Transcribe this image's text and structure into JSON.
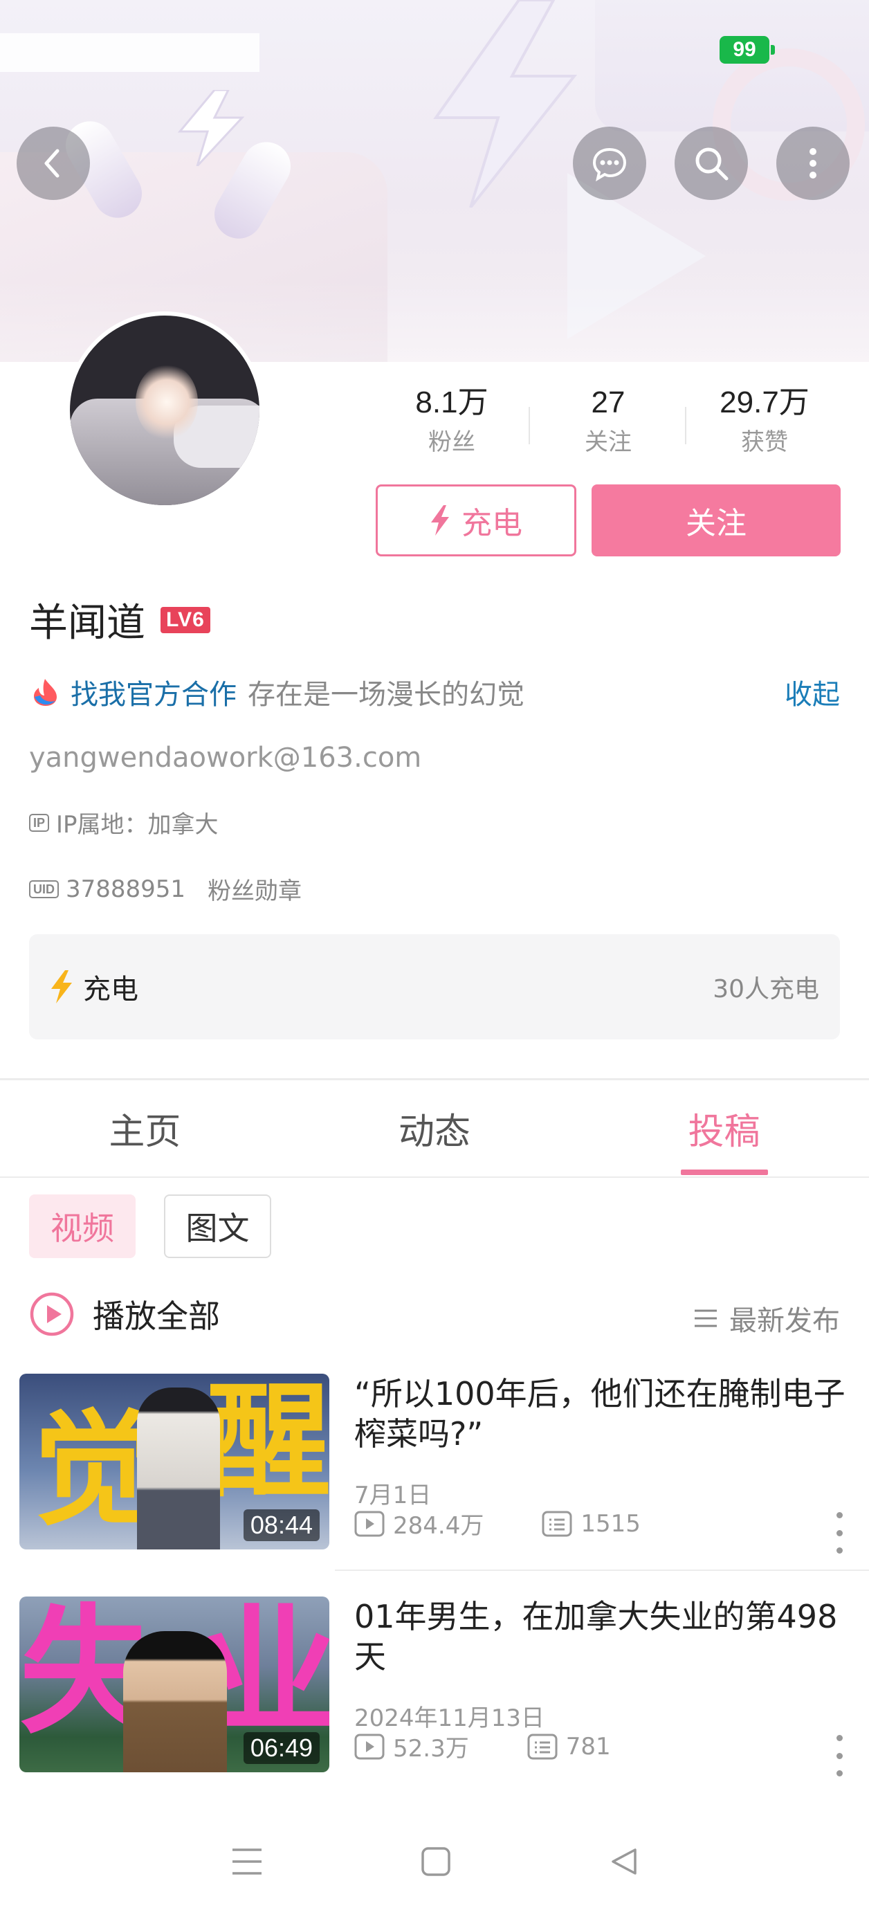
{
  "status": {
    "battery": "99",
    "battery_color": "#19b84a"
  },
  "header": {
    "back_icon": "chevron-left-icon",
    "message_icon": "chat-bubble-icon",
    "search_icon": "search-icon",
    "more_icon": "more-vertical-icon"
  },
  "profile": {
    "name": "羊闻道",
    "level": "LV6",
    "stats": [
      {
        "num": "8.1万",
        "label": "粉丝"
      },
      {
        "num": "27",
        "label": "关注"
      },
      {
        "num": "29.7万",
        "label": "获赞"
      }
    ],
    "charge_button": "充电",
    "follow_button": "关注",
    "coop_label": "找我官方合作",
    "signature": "存在是一场漫长的幻觉",
    "collapse_label": "收起",
    "email": "yangwendaowork@163.com",
    "ip_tag": "IP",
    "ip_location": "IP属地：加拿大",
    "uid_tag": "UID",
    "uid": "37888951",
    "fan_medal": "粉丝勋章",
    "charge_card_label": "充电",
    "charge_count": "30人充电"
  },
  "tabs": [
    {
      "label": "主页"
    },
    {
      "label": "动态"
    },
    {
      "label": "投稿",
      "active": true
    }
  ],
  "filters": {
    "video": "视频",
    "article": "图文"
  },
  "list_header": {
    "play_all": "播放全部",
    "sort": "最新发布"
  },
  "videos": [
    {
      "title": "“所以100年后，他们还在腌制电子榨菜吗?”",
      "thumb_text": [
        "觉",
        "醒"
      ],
      "duration": "08:44",
      "date": "7月1日",
      "views": "284.4万",
      "comments": "1515"
    },
    {
      "title": "01年男生，在加拿大失业的第498天",
      "thumb_text": [
        "失",
        "业"
      ],
      "duration": "06:49",
      "date": "2024年11月13日",
      "views": "52.3万",
      "comments": "781"
    }
  ],
  "colors": {
    "accent": "#f0769c",
    "follow_bg": "#f57a9f",
    "link": "#1a6fa8"
  }
}
